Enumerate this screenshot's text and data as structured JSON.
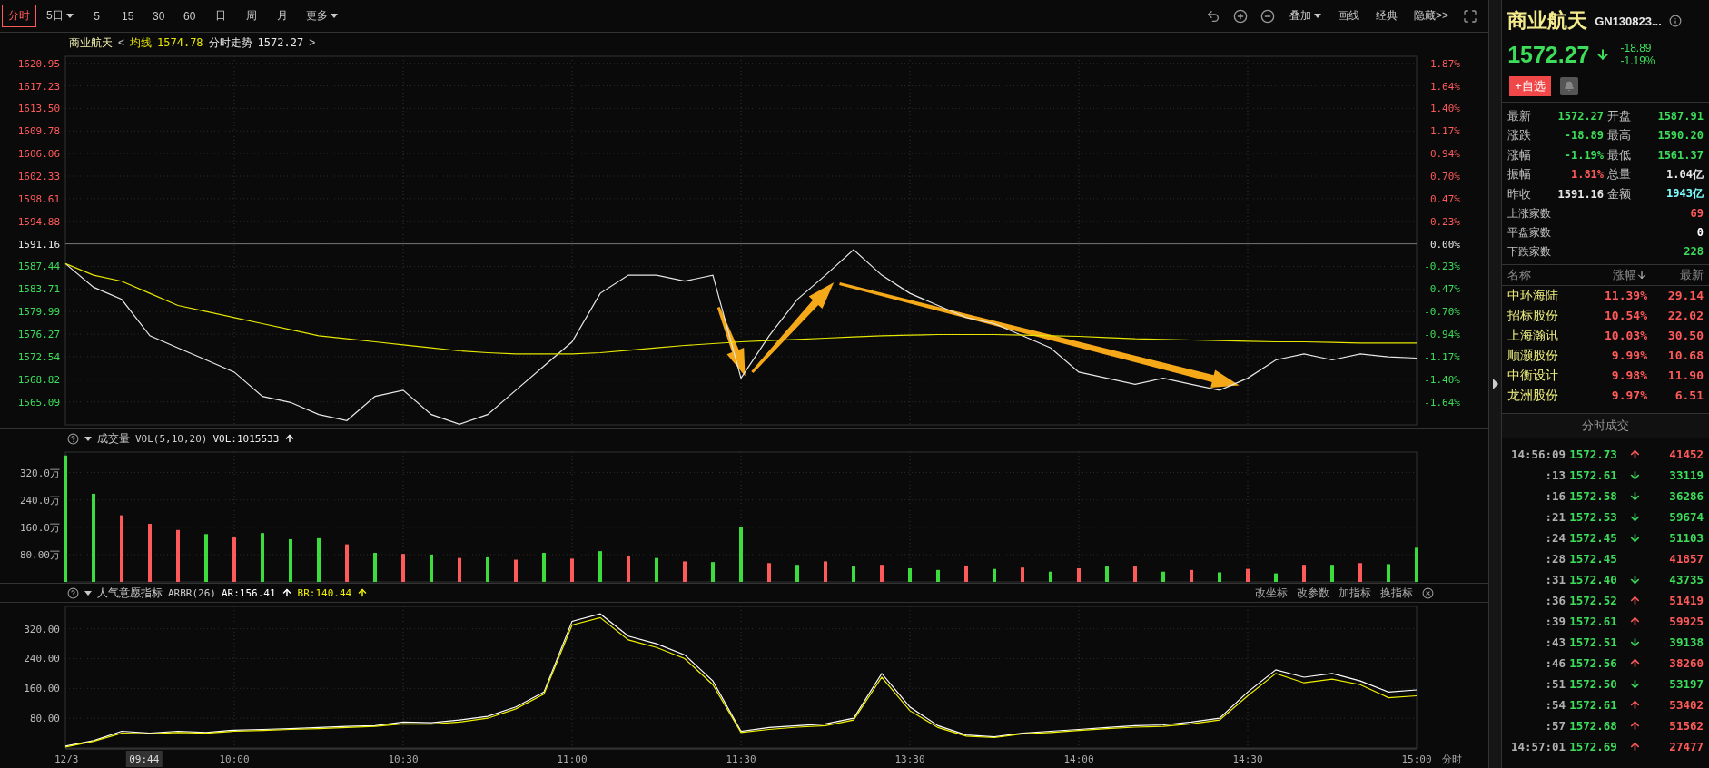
{
  "toolbar": {
    "periods": [
      {
        "label": "分时",
        "selected": true,
        "dropdown": false
      },
      {
        "label": "5日",
        "selected": false,
        "dropdown": true
      },
      {
        "label": "5",
        "selected": false,
        "dropdown": false
      },
      {
        "label": "15",
        "selected": false,
        "dropdown": false
      },
      {
        "label": "30",
        "selected": false,
        "dropdown": false
      },
      {
        "label": "60",
        "selected": false,
        "dropdown": false
      },
      {
        "label": "日",
        "selected": false,
        "dropdown": false
      },
      {
        "label": "周",
        "selected": false,
        "dropdown": false
      },
      {
        "label": "月",
        "selected": false,
        "dropdown": false
      },
      {
        "label": "更多",
        "selected": false,
        "dropdown": true
      }
    ],
    "tools": [
      {
        "kind": "undo"
      },
      {
        "kind": "zoom-in"
      },
      {
        "kind": "zoom-out"
      },
      {
        "kind": "text",
        "label": "叠加",
        "dropdown": true
      },
      {
        "kind": "text",
        "label": "画线",
        "dropdown": false
      },
      {
        "kind": "text",
        "label": "经典",
        "dropdown": false
      },
      {
        "kind": "text",
        "label": "隐藏>>",
        "dropdown": false
      },
      {
        "kind": "fullscreen"
      }
    ]
  },
  "main_chart": {
    "header": {
      "name": "商业航天",
      "prev": "<",
      "avg_value": "1574.78",
      "trend_value": "1572.27",
      "next": ">"
    },
    "percent_labels": [
      "1.87%",
      "1.64%",
      "1.40%",
      "1.17%",
      "0.94%",
      "0.70%",
      "0.47%",
      "0.23%",
      "0.00%",
      "-0.23%",
      "-0.47%",
      "-0.70%",
      "-0.94%",
      "-1.17%",
      "-1.40%",
      "-1.64%"
    ],
    "drawn_arrows": [
      {
        "kind": "arrow"
      },
      {
        "kind": "arrow"
      },
      {
        "kind": "arrow"
      }
    ],
    "chart_data": {
      "type": "line",
      "grid": true,
      "ylim": [
        1561.3,
        1622.1
      ],
      "yticks": [
        {
          "value": 1620.95,
          "label": "1620.95"
        },
        {
          "value": 1617.23,
          "label": "1617.23"
        },
        {
          "value": 1613.5,
          "label": "1613.50"
        },
        {
          "value": 1609.78,
          "label": "1609.78"
        },
        {
          "value": 1606.06,
          "label": "1606.06"
        },
        {
          "value": 1602.33,
          "label": "1602.33"
        },
        {
          "value": 1598.61,
          "label": "1598.61"
        },
        {
          "value": 1594.88,
          "label": "1594.88"
        },
        {
          "value": 1591.16,
          "label": "1591.16"
        },
        {
          "value": 1587.44,
          "label": "1587.44"
        },
        {
          "value": 1583.71,
          "label": "1583.71"
        },
        {
          "value": 1579.99,
          "label": "1579.99"
        },
        {
          "value": 1576.27,
          "label": "1576.27"
        },
        {
          "value": 1572.54,
          "label": "1572.54"
        },
        {
          "value": 1568.82,
          "label": "1568.82"
        },
        {
          "value": 1565.09,
          "label": "1565.09"
        }
      ],
      "ref_lines": [
        {
          "axis": "y",
          "value": 1591.16
        }
      ],
      "series": [
        {
          "name": "分时走势",
          "color": "#e8e8e8",
          "values": [
            1587.9,
            1584,
            1582,
            1576,
            1574,
            1572,
            1570,
            1566,
            1565,
            1563,
            1562,
            1566,
            1567,
            1563,
            1561.4,
            1563,
            1567,
            1571,
            1575,
            1583,
            1586,
            1586,
            1585,
            1586,
            1569,
            1576,
            1582,
            1586,
            1590.2,
            1586,
            1583,
            1581,
            1579,
            1578,
            1576,
            1574,
            1570,
            1569,
            1568,
            1569,
            1568,
            1567,
            1569,
            1572,
            1573,
            1572,
            1573,
            1572.5,
            1572.3
          ]
        },
        {
          "name": "均线",
          "color": "#e6e600",
          "values": [
            1587.9,
            1586,
            1585,
            1583,
            1581,
            1580,
            1579,
            1578,
            1577,
            1576,
            1575.5,
            1575,
            1574.5,
            1574,
            1573.5,
            1573.2,
            1573,
            1573,
            1573,
            1573.2,
            1573.6,
            1574,
            1574.4,
            1574.7,
            1575,
            1575.2,
            1575.4,
            1575.6,
            1575.8,
            1576,
            1576.1,
            1576.2,
            1576.2,
            1576.2,
            1576.1,
            1576,
            1575.9,
            1575.7,
            1575.5,
            1575.4,
            1575.3,
            1575.2,
            1575.1,
            1575,
            1575,
            1574.9,
            1574.8,
            1574.8,
            1574.8
          ]
        }
      ]
    }
  },
  "volume_chart": {
    "header": {
      "title": "成交量",
      "params": "VOL(5,10,20)",
      "reading": "VOL:1015533",
      "rising": true
    },
    "chart_data": {
      "type": "bar",
      "grid": true,
      "ylim": [
        0,
        380
      ],
      "yticks": [
        {
          "value": 80,
          "label": "80.00万"
        },
        {
          "value": 160,
          "label": "160.0万"
        },
        {
          "value": 240,
          "label": "240.0万"
        },
        {
          "value": 320,
          "label": "320.0万"
        }
      ],
      "series": [
        {
          "color": "#ff5a5a",
          "values": [
            null,
            null,
            195,
            170,
            152,
            null,
            130,
            null,
            null,
            null,
            110,
            null,
            82,
            null,
            70,
            null,
            65,
            null,
            68,
            null,
            75,
            null,
            60,
            null,
            null,
            55,
            null,
            60,
            null,
            50,
            null,
            null,
            48,
            null,
            42,
            null,
            40,
            null,
            45,
            null,
            35,
            null,
            38,
            null,
            50,
            null,
            55,
            null,
            null
          ]
        },
        {
          "color": "#3ddc3d",
          "values": [
            370,
            258,
            null,
            null,
            null,
            140,
            null,
            143,
            125,
            128,
            null,
            85,
            null,
            80,
            null,
            72,
            null,
            85,
            null,
            90,
            null,
            70,
            null,
            58,
            160,
            null,
            50,
            null,
            45,
            null,
            40,
            35,
            null,
            38,
            null,
            30,
            null,
            45,
            null,
            30,
            null,
            28,
            null,
            25,
            null,
            50,
            null,
            52,
            100
          ]
        }
      ]
    }
  },
  "arbr_chart": {
    "header": {
      "title": "人气意愿指标",
      "params": "ARBR(26)",
      "readings": [
        {
          "label": "AR:156.41",
          "rising": true,
          "color": "#ffffff"
        },
        {
          "label": "BR:140.44",
          "rising": true,
          "color": "#f0f000"
        }
      ],
      "actions": [
        "改坐标",
        "改参数",
        "加指标",
        "换指标"
      ]
    },
    "axis_end_label": "分时",
    "cursor_label": "09:44",
    "chart_data": {
      "type": "line",
      "grid": true,
      "ylim": [
        0,
        380
      ],
      "categories": [
        "12/3",
        null,
        null,
        null,
        null,
        null,
        "10:00",
        null,
        null,
        null,
        null,
        null,
        "10:30",
        null,
        null,
        null,
        null,
        null,
        "11:00",
        null,
        null,
        null,
        null,
        null,
        "11:30",
        null,
        null,
        null,
        null,
        null,
        "13:30",
        null,
        null,
        null,
        null,
        null,
        "14:00",
        null,
        null,
        null,
        null,
        null,
        "14:30",
        null,
        null,
        null,
        null,
        null,
        "15:00"
      ],
      "yticks": [
        {
          "value": 80,
          "label": "80.00"
        },
        {
          "value": 160,
          "label": "160.00"
        },
        {
          "value": 240,
          "label": "240.00"
        },
        {
          "value": 320,
          "label": "320.00"
        }
      ],
      "series": [
        {
          "color": "#ffffff",
          "values": [
            5,
            20,
            45,
            40,
            45,
            42,
            48,
            50,
            52,
            55,
            58,
            60,
            70,
            68,
            75,
            85,
            110,
            150,
            340,
            360,
            300,
            280,
            250,
            180,
            45,
            55,
            60,
            65,
            80,
            200,
            110,
            60,
            35,
            30,
            40,
            45,
            50,
            55,
            60,
            62,
            70,
            80,
            150,
            210,
            190,
            200,
            180,
            150,
            156
          ]
        },
        {
          "color": "#f0f000",
          "values": [
            3,
            18,
            40,
            38,
            42,
            40,
            45,
            47,
            50,
            52,
            55,
            58,
            65,
            64,
            70,
            80,
            105,
            145,
            330,
            350,
            290,
            270,
            240,
            170,
            42,
            50,
            56,
            60,
            75,
            190,
            100,
            55,
            32,
            28,
            38,
            42,
            47,
            52,
            56,
            58,
            65,
            75,
            140,
            200,
            175,
            185,
            170,
            135,
            140
          ]
        }
      ]
    }
  },
  "quote": {
    "name": "商业航天",
    "code": "GN130823...",
    "price": "1572.27",
    "falling": true,
    "change": "-18.89",
    "change_pct": "-1.19%",
    "watch_button": "+自选",
    "stats": [
      {
        "label": "最新",
        "value": "1572.27",
        "color": "#3ddc5a"
      },
      {
        "label": "开盘",
        "value": "1587.91",
        "color": "#3ddc5a"
      },
      {
        "label": "涨跌",
        "value": "-18.89",
        "color": "#3ddc5a"
      },
      {
        "label": "最高",
        "value": "1590.20",
        "color": "#3ddc5a"
      },
      {
        "label": "涨幅",
        "value": "-1.19%",
        "color": "#3ddc5a"
      },
      {
        "label": "最低",
        "value": "1561.37",
        "color": "#3ddc5a"
      },
      {
        "label": "振幅",
        "value": "1.81%",
        "color": "#ff5a5a"
      },
      {
        "label": "总量",
        "value": "1.04亿",
        "color": "#e8e8e8"
      },
      {
        "label": "昨收",
        "value": "1591.16",
        "color": "#e8e8e8"
      },
      {
        "label": "金额",
        "value": "1943亿",
        "color": "#7fffff"
      }
    ],
    "counts": [
      {
        "label": "上涨家数",
        "value": "69",
        "color": "#ff5a5a"
      },
      {
        "label": "平盘家数",
        "value": "0",
        "color": "#ffffff"
      },
      {
        "label": "下跌家数",
        "value": "228",
        "color": "#3ddc5a"
      }
    ]
  },
  "constituents": {
    "columns": [
      {
        "label": "名称",
        "sorted": false
      },
      {
        "label": "涨幅",
        "sorted": true
      },
      {
        "label": "最新",
        "sorted": false
      }
    ],
    "rows": [
      {
        "name": "中环海陆",
        "pct": "11.39%",
        "last": "29.14"
      },
      {
        "name": "招标股份",
        "pct": "10.54%",
        "last": "22.02"
      },
      {
        "name": "上海瀚讯",
        "pct": "10.03%",
        "last": "30.50"
      },
      {
        "name": "顺灏股份",
        "pct": "9.99%",
        "last": "10.68"
      },
      {
        "name": "中衡设计",
        "pct": "9.98%",
        "last": "11.90"
      },
      {
        "name": "龙洲股份",
        "pct": "9.97%",
        "last": "6.51"
      }
    ]
  },
  "trades": {
    "title": "分时成交",
    "rows": [
      {
        "time": "14:56:09",
        "price": "1572.73",
        "rising": true,
        "falling": false,
        "volume": "41452",
        "color": "#ff5a5a"
      },
      {
        "time": ":13",
        "price": "1572.61",
        "rising": false,
        "falling": true,
        "volume": "33119",
        "color": "#3ddc5a"
      },
      {
        "time": ":16",
        "price": "1572.58",
        "rising": false,
        "falling": true,
        "volume": "36286",
        "color": "#3ddc5a"
      },
      {
        "time": ":21",
        "price": "1572.53",
        "rising": false,
        "falling": true,
        "volume": "59674",
        "color": "#3ddc5a"
      },
      {
        "time": ":24",
        "price": "1572.45",
        "rising": false,
        "falling": true,
        "volume": "51103",
        "color": "#3ddc5a"
      },
      {
        "time": ":28",
        "price": "1572.45",
        "rising": false,
        "falling": false,
        "volume": "41857",
        "color": "#ff5a5a"
      },
      {
        "time": ":31",
        "price": "1572.40",
        "rising": false,
        "falling": true,
        "volume": "43735",
        "color": "#3ddc5a"
      },
      {
        "time": ":36",
        "price": "1572.52",
        "rising": true,
        "falling": false,
        "volume": "51419",
        "color": "#ff5a5a"
      },
      {
        "time": ":39",
        "price": "1572.61",
        "rising": true,
        "falling": false,
        "volume": "59925",
        "color": "#ff5a5a"
      },
      {
        "time": ":43",
        "price": "1572.51",
        "rising": false,
        "falling": true,
        "volume": "39138",
        "color": "#3ddc5a"
      },
      {
        "time": ":46",
        "price": "1572.56",
        "rising": true,
        "falling": false,
        "volume": "38260",
        "color": "#ff5a5a"
      },
      {
        "time": ":51",
        "price": "1572.50",
        "rising": false,
        "falling": true,
        "volume": "53197",
        "color": "#3ddc5a"
      },
      {
        "time": ":54",
        "price": "1572.61",
        "rising": true,
        "falling": false,
        "volume": "53402",
        "color": "#ff5a5a"
      },
      {
        "time": ":57",
        "price": "1572.68",
        "rising": true,
        "falling": false,
        "volume": "51562",
        "color": "#ff5a5a"
      },
      {
        "time": "14:57:01",
        "price": "1572.69",
        "rising": true,
        "falling": false,
        "volume": "27477",
        "color": "#ff5a5a"
      }
    ]
  }
}
